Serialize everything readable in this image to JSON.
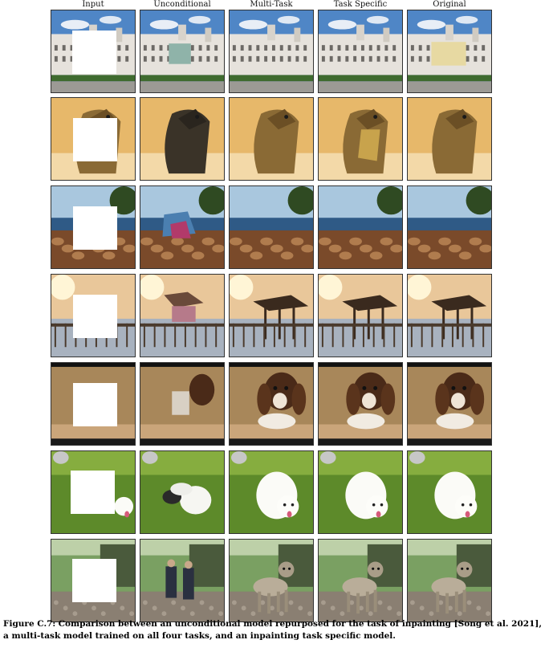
{
  "columns": [
    "Input",
    "Unconditional",
    "Multi-Task",
    "Task Specific",
    "Original"
  ],
  "rows": [
    {
      "subject": "palace"
    },
    {
      "subject": "iguana"
    },
    {
      "subject": "lakeshore-rocks"
    },
    {
      "subject": "pier-sunset"
    },
    {
      "subject": "spaniel"
    },
    {
      "subject": "white-dog-grass"
    },
    {
      "subject": "terrier-trail"
    }
  ],
  "caption": {
    "label": "Figure C.7:",
    "text": "Comparison between an unconditional model repurposed for the task of inpainting [Song et al. 2021], a multi-task model trained on all four tasks, and an inpainting task specific model."
  }
}
